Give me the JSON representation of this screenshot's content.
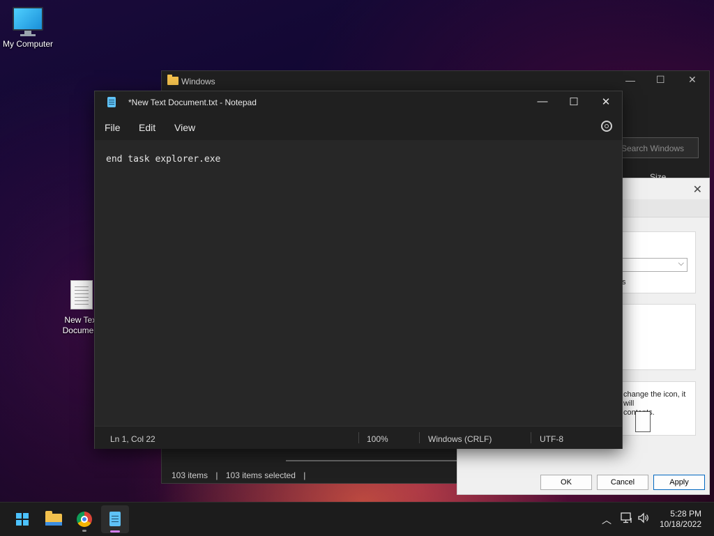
{
  "desktop": {
    "icons": [
      {
        "label": "My Computer"
      },
      {
        "label": "New Text Document"
      }
    ]
  },
  "explorer": {
    "title": "Windows",
    "search_placeholder": "Search Windows",
    "column_size": "Size",
    "status_items": "103 items",
    "status_selected": "103 items selected"
  },
  "properties_dialog": {
    "text_line1": "change the icon, it will",
    "text_line2": "contents.",
    "small_label": "s",
    "buttons": {
      "ok": "OK",
      "cancel": "Cancel",
      "apply": "Apply"
    }
  },
  "notepad": {
    "title": "*New Text Document.txt - Notepad",
    "menu": {
      "file": "File",
      "edit": "Edit",
      "view": "View"
    },
    "content": "end task explorer.exe",
    "status": {
      "position": "Ln 1, Col 22",
      "zoom": "100%",
      "line_ending": "Windows (CRLF)",
      "encoding": "UTF-8"
    }
  },
  "taskbar": {
    "clock_time": "5:28 PM",
    "clock_date": "10/18/2022",
    "accent_color": "#4cc2ff"
  }
}
